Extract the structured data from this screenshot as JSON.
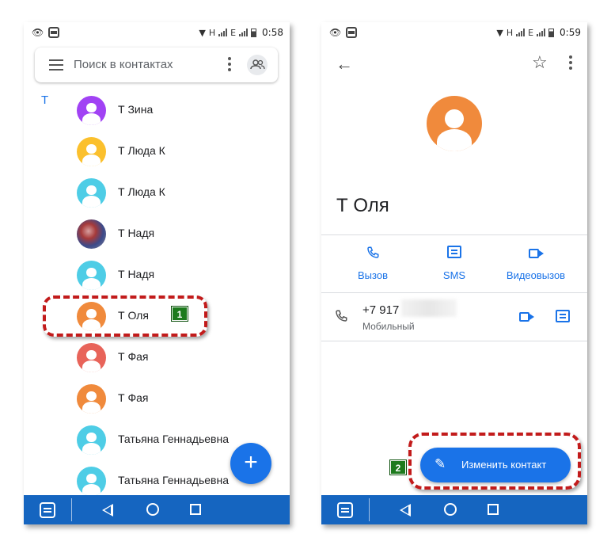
{
  "left_screen": {
    "status": {
      "time": "0:58",
      "net1": "H",
      "net2": "E"
    },
    "search": {
      "placeholder": "Поиск в контактах"
    },
    "section_letter": "Т",
    "contacts": [
      {
        "name": "Т Зина",
        "color": "#a142f4"
      },
      {
        "name": "Т Люда К",
        "color": "#fbc02d"
      },
      {
        "name": "Т Люда К",
        "color": "#4ecde6"
      },
      {
        "name": "Т Надя",
        "color": "photo"
      },
      {
        "name": "Т Надя",
        "color": "#4ecde6"
      },
      {
        "name": "Т Оля",
        "color": "#f08a3c"
      },
      {
        "name": "Т Фая",
        "color": "#e8645a"
      },
      {
        "name": "Т Фая",
        "color": "#f08a3c"
      },
      {
        "name": "Татьяна Геннадьевна",
        "color": "#4ecde6"
      },
      {
        "name": "Татьяна Геннадьевна",
        "color": "#4ecde6"
      }
    ],
    "fab_label": "+",
    "step_badge": "1"
  },
  "right_screen": {
    "status": {
      "time": "0:59",
      "net1": "H",
      "net2": "E"
    },
    "contact_name": "Т Оля",
    "avatar_color": "#f08a3c",
    "actions": {
      "call": "Вызов",
      "sms": "SMS",
      "video": "Видеовызов"
    },
    "phone_number": "+7 917",
    "phone_type": "Мобильный",
    "edit_button": "Изменить контакт",
    "step_badge": "2"
  },
  "colors": {
    "accent": "#1a73e8",
    "nav": "#1565c0",
    "highlight": "#c21b1b",
    "badge": "#1d7a1d"
  }
}
